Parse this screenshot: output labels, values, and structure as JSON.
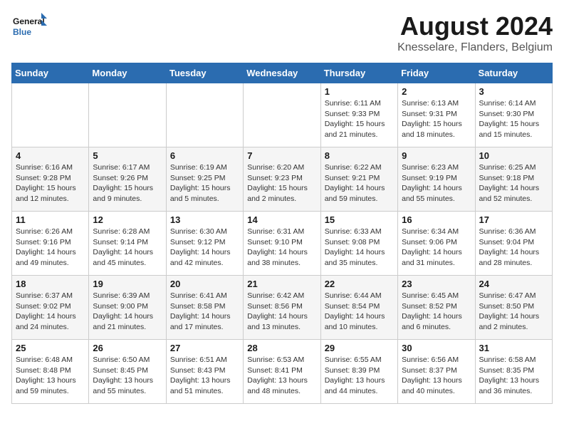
{
  "header": {
    "logo_text_general": "General",
    "logo_text_blue": "Blue",
    "main_title": "August 2024",
    "subtitle": "Knesselare, Flanders, Belgium"
  },
  "calendar": {
    "days_of_week": [
      "Sunday",
      "Monday",
      "Tuesday",
      "Wednesday",
      "Thursday",
      "Friday",
      "Saturday"
    ],
    "weeks": [
      [
        {
          "day": "",
          "info": ""
        },
        {
          "day": "",
          "info": ""
        },
        {
          "day": "",
          "info": ""
        },
        {
          "day": "",
          "info": ""
        },
        {
          "day": "1",
          "info": "Sunrise: 6:11 AM\nSunset: 9:33 PM\nDaylight: 15 hours\nand 21 minutes."
        },
        {
          "day": "2",
          "info": "Sunrise: 6:13 AM\nSunset: 9:31 PM\nDaylight: 15 hours\nand 18 minutes."
        },
        {
          "day": "3",
          "info": "Sunrise: 6:14 AM\nSunset: 9:30 PM\nDaylight: 15 hours\nand 15 minutes."
        }
      ],
      [
        {
          "day": "4",
          "info": "Sunrise: 6:16 AM\nSunset: 9:28 PM\nDaylight: 15 hours\nand 12 minutes."
        },
        {
          "day": "5",
          "info": "Sunrise: 6:17 AM\nSunset: 9:26 PM\nDaylight: 15 hours\nand 9 minutes."
        },
        {
          "day": "6",
          "info": "Sunrise: 6:19 AM\nSunset: 9:25 PM\nDaylight: 15 hours\nand 5 minutes."
        },
        {
          "day": "7",
          "info": "Sunrise: 6:20 AM\nSunset: 9:23 PM\nDaylight: 15 hours\nand 2 minutes."
        },
        {
          "day": "8",
          "info": "Sunrise: 6:22 AM\nSunset: 9:21 PM\nDaylight: 14 hours\nand 59 minutes."
        },
        {
          "day": "9",
          "info": "Sunrise: 6:23 AM\nSunset: 9:19 PM\nDaylight: 14 hours\nand 55 minutes."
        },
        {
          "day": "10",
          "info": "Sunrise: 6:25 AM\nSunset: 9:18 PM\nDaylight: 14 hours\nand 52 minutes."
        }
      ],
      [
        {
          "day": "11",
          "info": "Sunrise: 6:26 AM\nSunset: 9:16 PM\nDaylight: 14 hours\nand 49 minutes."
        },
        {
          "day": "12",
          "info": "Sunrise: 6:28 AM\nSunset: 9:14 PM\nDaylight: 14 hours\nand 45 minutes."
        },
        {
          "day": "13",
          "info": "Sunrise: 6:30 AM\nSunset: 9:12 PM\nDaylight: 14 hours\nand 42 minutes."
        },
        {
          "day": "14",
          "info": "Sunrise: 6:31 AM\nSunset: 9:10 PM\nDaylight: 14 hours\nand 38 minutes."
        },
        {
          "day": "15",
          "info": "Sunrise: 6:33 AM\nSunset: 9:08 PM\nDaylight: 14 hours\nand 35 minutes."
        },
        {
          "day": "16",
          "info": "Sunrise: 6:34 AM\nSunset: 9:06 PM\nDaylight: 14 hours\nand 31 minutes."
        },
        {
          "day": "17",
          "info": "Sunrise: 6:36 AM\nSunset: 9:04 PM\nDaylight: 14 hours\nand 28 minutes."
        }
      ],
      [
        {
          "day": "18",
          "info": "Sunrise: 6:37 AM\nSunset: 9:02 PM\nDaylight: 14 hours\nand 24 minutes."
        },
        {
          "day": "19",
          "info": "Sunrise: 6:39 AM\nSunset: 9:00 PM\nDaylight: 14 hours\nand 21 minutes."
        },
        {
          "day": "20",
          "info": "Sunrise: 6:41 AM\nSunset: 8:58 PM\nDaylight: 14 hours\nand 17 minutes."
        },
        {
          "day": "21",
          "info": "Sunrise: 6:42 AM\nSunset: 8:56 PM\nDaylight: 14 hours\nand 13 minutes."
        },
        {
          "day": "22",
          "info": "Sunrise: 6:44 AM\nSunset: 8:54 PM\nDaylight: 14 hours\nand 10 minutes."
        },
        {
          "day": "23",
          "info": "Sunrise: 6:45 AM\nSunset: 8:52 PM\nDaylight: 14 hours\nand 6 minutes."
        },
        {
          "day": "24",
          "info": "Sunrise: 6:47 AM\nSunset: 8:50 PM\nDaylight: 14 hours\nand 2 minutes."
        }
      ],
      [
        {
          "day": "25",
          "info": "Sunrise: 6:48 AM\nSunset: 8:48 PM\nDaylight: 13 hours\nand 59 minutes."
        },
        {
          "day": "26",
          "info": "Sunrise: 6:50 AM\nSunset: 8:45 PM\nDaylight: 13 hours\nand 55 minutes."
        },
        {
          "day": "27",
          "info": "Sunrise: 6:51 AM\nSunset: 8:43 PM\nDaylight: 13 hours\nand 51 minutes."
        },
        {
          "day": "28",
          "info": "Sunrise: 6:53 AM\nSunset: 8:41 PM\nDaylight: 13 hours\nand 48 minutes."
        },
        {
          "day": "29",
          "info": "Sunrise: 6:55 AM\nSunset: 8:39 PM\nDaylight: 13 hours\nand 44 minutes."
        },
        {
          "day": "30",
          "info": "Sunrise: 6:56 AM\nSunset: 8:37 PM\nDaylight: 13 hours\nand 40 minutes."
        },
        {
          "day": "31",
          "info": "Sunrise: 6:58 AM\nSunset: 8:35 PM\nDaylight: 13 hours\nand 36 minutes."
        }
      ]
    ]
  }
}
